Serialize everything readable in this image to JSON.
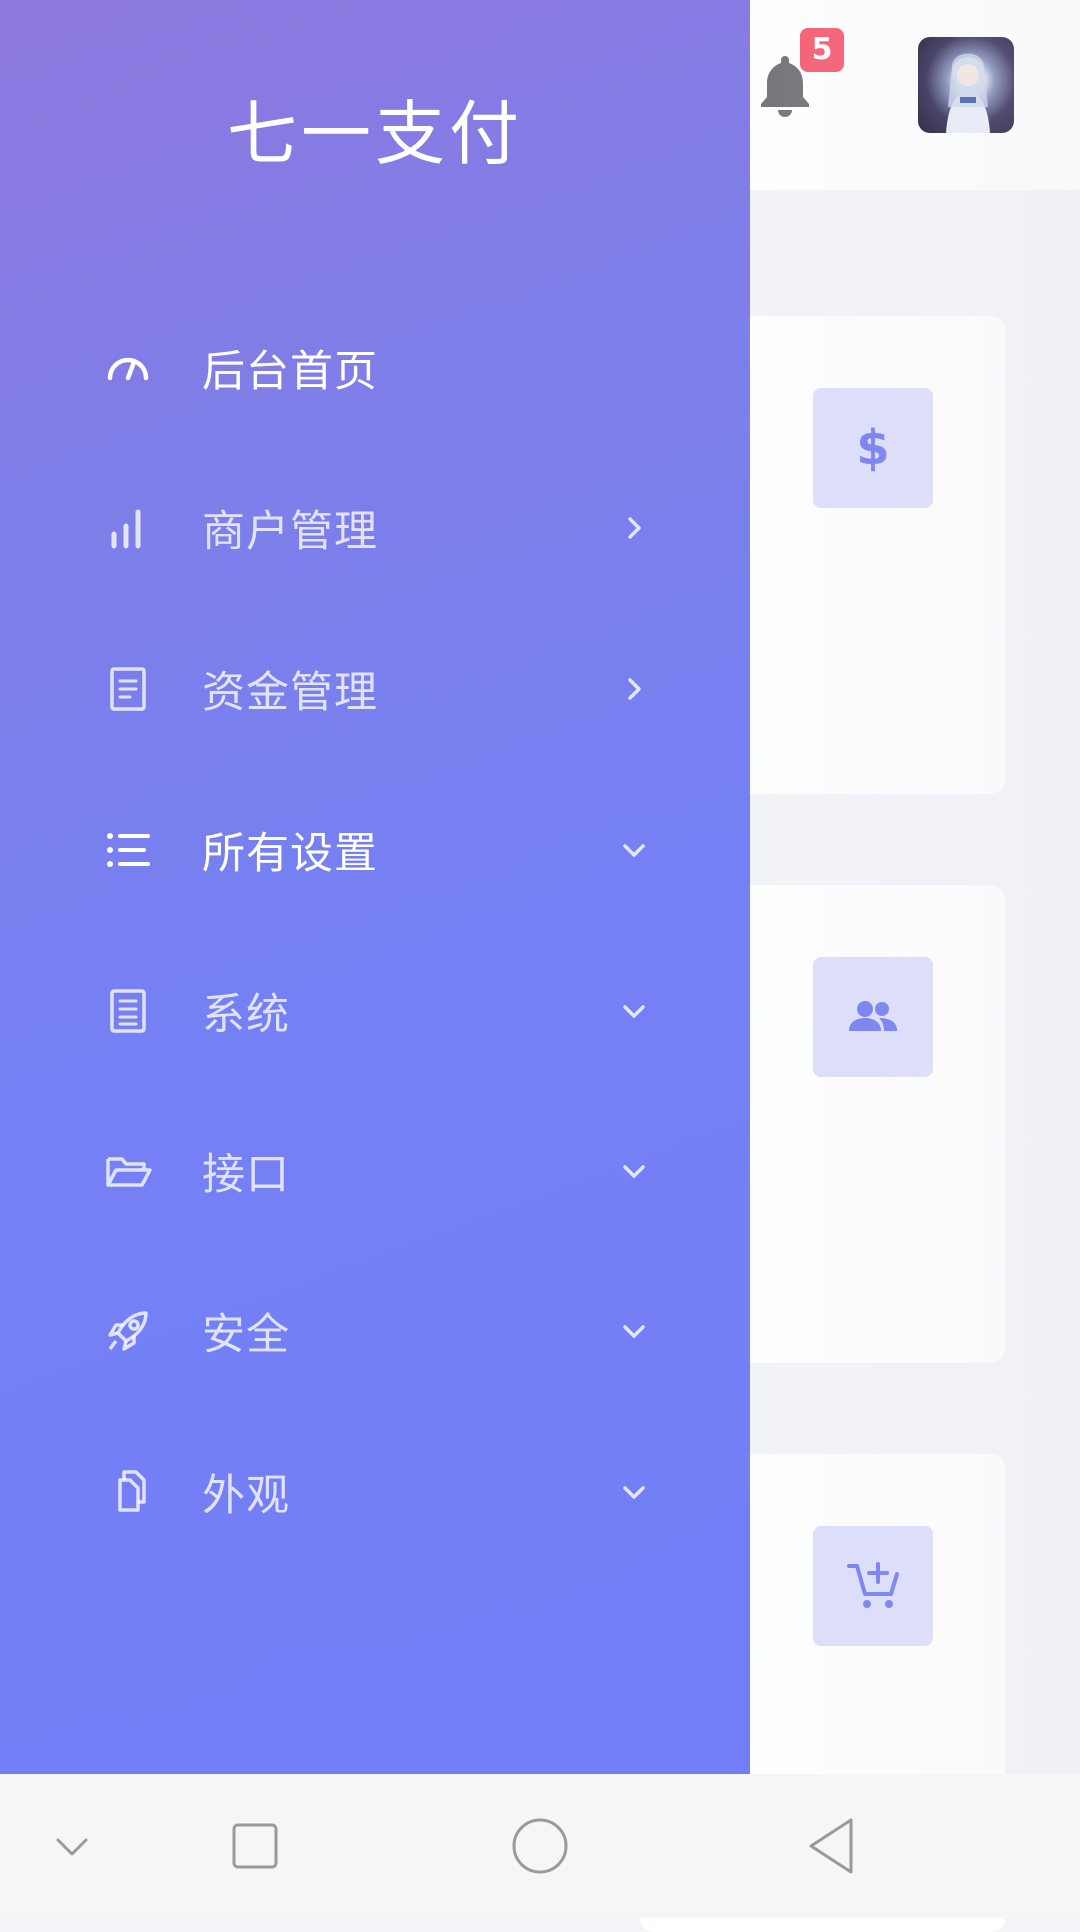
{
  "app": {
    "title": "七一支付"
  },
  "header": {
    "notification_count": "5"
  },
  "menu": [
    {
      "label": "后台首页",
      "icon": "dashboard-gauge-icon",
      "arrow": "none",
      "active": true
    },
    {
      "label": "商户管理",
      "icon": "bar-chart-icon",
      "arrow": "chevron-right"
    },
    {
      "label": "资金管理",
      "icon": "document-icon",
      "arrow": "chevron-right"
    },
    {
      "label": "所有设置",
      "icon": "list-icon",
      "arrow": "chevron-down",
      "active": true
    },
    {
      "label": "系统",
      "icon": "file-text-icon",
      "arrow": "chevron-down"
    },
    {
      "label": "接口",
      "icon": "folder-open-icon",
      "arrow": "chevron-down"
    },
    {
      "label": "安全",
      "icon": "rocket-icon",
      "arrow": "chevron-down"
    },
    {
      "label": "外观",
      "icon": "copy-files-icon",
      "arrow": "chevron-down"
    }
  ],
  "cards": [
    {
      "icon": "dollar-icon"
    },
    {
      "icon": "users-icon"
    },
    {
      "icon": "cart-add-icon"
    }
  ],
  "colors": {
    "accent": "#6f79ef",
    "badge": "#f5586e",
    "card_icon_bg": "#dcddfb",
    "drawer_top": "#8d78de",
    "drawer_bottom": "#737ef6"
  },
  "navbar": [
    {
      "icon": "collapse-chevron-icon"
    },
    {
      "icon": "recent-apps-square-icon"
    },
    {
      "icon": "home-circle-icon"
    },
    {
      "icon": "back-triangle-icon"
    }
  ]
}
